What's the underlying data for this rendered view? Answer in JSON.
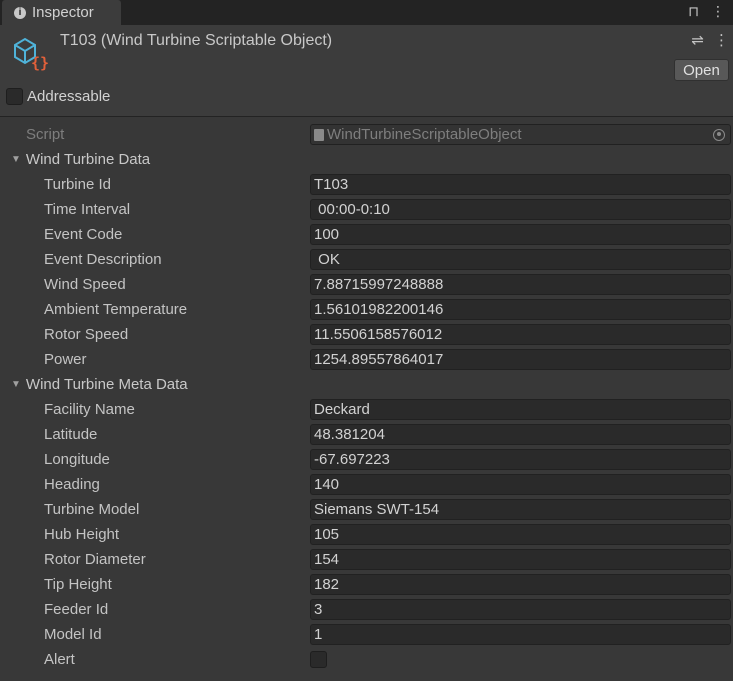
{
  "tab": {
    "label": "Inspector"
  },
  "header": {
    "title": "T103 (Wind Turbine Scriptable Object)",
    "open_label": "Open",
    "addressable_label": "Addressable",
    "addressable_checked": false
  },
  "script": {
    "label": "Script",
    "value": "WindTurbineScriptableObject"
  },
  "sections": [
    {
      "title": "Wind Turbine Data",
      "fields": [
        {
          "label": "Turbine Id",
          "value": "T103"
        },
        {
          "label": "Time Interval",
          "value": " 00:00-0:10"
        },
        {
          "label": "Event Code",
          "value": "100"
        },
        {
          "label": "Event Description",
          "value": " OK"
        },
        {
          "label": "Wind Speed",
          "value": "7.88715997248888"
        },
        {
          "label": "Ambient Temperature",
          "value": "1.56101982200146"
        },
        {
          "label": "Rotor Speed",
          "value": "11.5506158576012"
        },
        {
          "label": "Power",
          "value": "1254.89557864017"
        }
      ]
    },
    {
      "title": "Wind Turbine Meta Data",
      "fields": [
        {
          "label": "Facility Name",
          "value": "Deckard"
        },
        {
          "label": "Latitude",
          "value": "48.381204"
        },
        {
          "label": "Longitude",
          "value": "-67.697223"
        },
        {
          "label": "Heading",
          "value": "140"
        },
        {
          "label": "Turbine Model",
          "value": "Siemans SWT-154"
        },
        {
          "label": "Hub Height",
          "value": "105"
        },
        {
          "label": "Rotor Diameter",
          "value": "154"
        },
        {
          "label": "Tip Height",
          "value": "182"
        },
        {
          "label": "Feeder Id",
          "value": "3"
        },
        {
          "label": "Model Id",
          "value": "1"
        }
      ]
    }
  ],
  "alert": {
    "label": "Alert",
    "checked": false
  }
}
